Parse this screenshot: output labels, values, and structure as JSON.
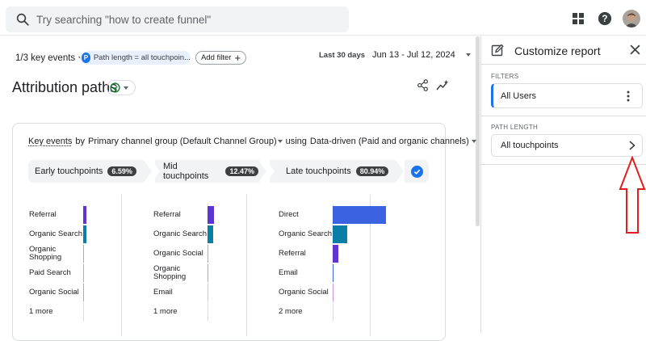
{
  "search": {
    "placeholder": "Try searching \"how to create funnel\""
  },
  "toolbar": {
    "key_events": "1/3 key events",
    "path_chip_badge": "P",
    "path_chip": "Path length = all touchpoin...",
    "add_filter": "Add filter",
    "add_filter_symbol": "+",
    "date_label": "Last 30 days",
    "date_range": "Jun 13 - Jul 12, 2024"
  },
  "page": {
    "title": "Attribution paths"
  },
  "card": {
    "header": {
      "key_events": "Key events",
      "by": "by",
      "dimension": "Primary channel group (Default Channel Group)",
      "using": "using",
      "model": "Data-driven (Paid and organic channels)"
    },
    "stages": [
      {
        "label": "Early touchpoints",
        "pct": "6.59%"
      },
      {
        "label": "Mid touchpoints",
        "pct": "12.47%"
      },
      {
        "label": "Late touchpoints",
        "pct": "80.94%"
      }
    ],
    "columns": [
      {
        "rows": [
          {
            "label": "Referral",
            "value": 0.04,
            "color": "#5e35d1"
          },
          {
            "label": "Organic Search",
            "value": 0.04,
            "color": "#0b7ea8"
          },
          {
            "label": "Organic Shopping",
            "value": 0.004,
            "color": "#b39ddb"
          },
          {
            "label": "Paid Search",
            "value": 0.005,
            "color": "#8ab4f8"
          },
          {
            "label": "Organic Social",
            "value": 0.002,
            "color": "#ce93d8"
          },
          {
            "label": "1 more",
            "value": 0.001,
            "color": "#dadce0"
          }
        ]
      },
      {
        "rows": [
          {
            "label": "Referral",
            "value": 0.08,
            "color": "#5e35d1"
          },
          {
            "label": "Organic Search",
            "value": 0.07,
            "color": "#0b7ea8"
          },
          {
            "label": "Organic Social",
            "value": 0.004,
            "color": "#ce93d8"
          },
          {
            "label": "Organic Shopping",
            "value": 0.003,
            "color": "#b39ddb"
          },
          {
            "label": "Email",
            "value": 0.002,
            "color": "#c5cae9"
          },
          {
            "label": "1 more",
            "value": 0.001,
            "color": "#dadce0"
          }
        ]
      },
      {
        "rows": [
          {
            "label": "Direct",
            "value": 0.66,
            "color": "#3b62e0"
          },
          {
            "label": "Organic Search",
            "value": 0.18,
            "color": "#0b7ea8"
          },
          {
            "label": "Referral",
            "value": 0.07,
            "color": "#5e35d1"
          },
          {
            "label": "Email",
            "value": 0.01,
            "color": "#3b62e0"
          },
          {
            "label": "Organic Social",
            "value": 0.003,
            "color": "#ce93d8"
          },
          {
            "label": "2 more",
            "value": 0.002,
            "color": "#dadce0"
          }
        ]
      }
    ]
  },
  "panel": {
    "title": "Customize report",
    "filters_label": "FILTERS",
    "filter_value": "All Users",
    "path_length_label": "PATH LENGTH",
    "path_length_value": "All touchpoints"
  },
  "colors": {
    "accent": "#1a73e8",
    "annotation_arrow": "#e02020"
  }
}
